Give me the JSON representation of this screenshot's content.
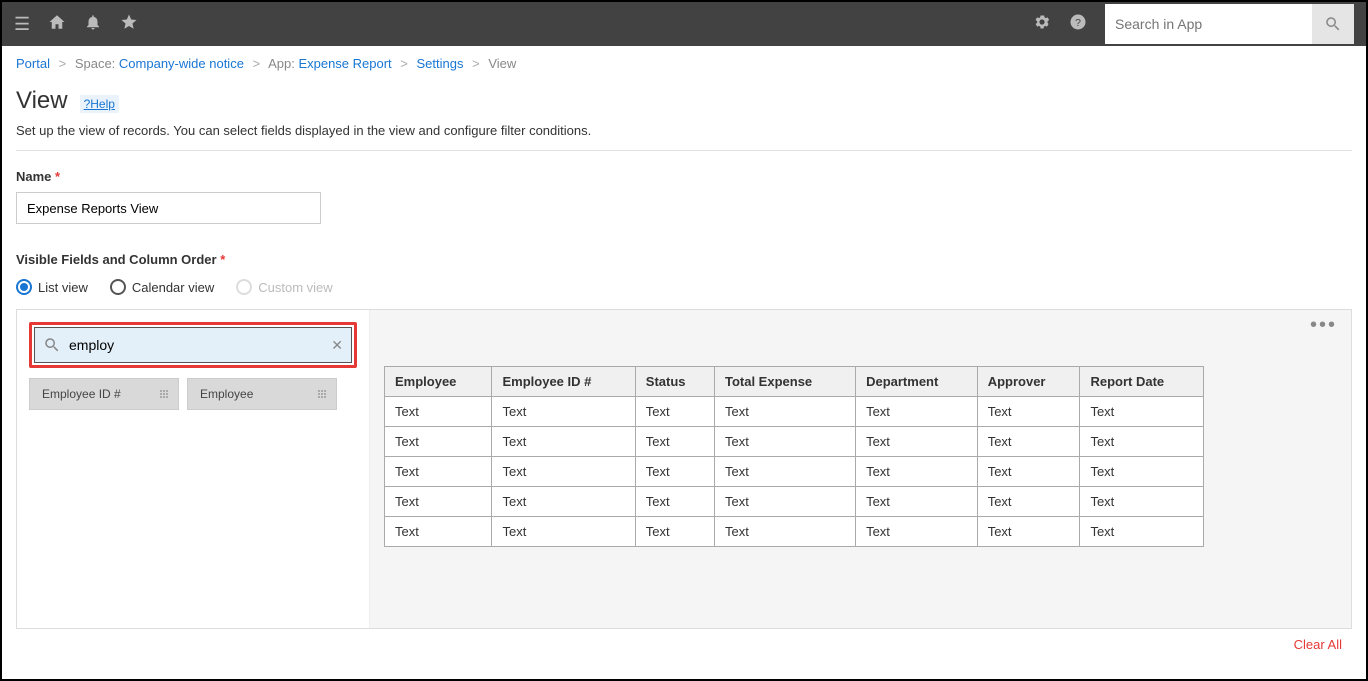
{
  "topbar": {
    "search_placeholder": "Search in App"
  },
  "breadcrumb": {
    "portal": "Portal",
    "space_label": "Space:",
    "space_name": "Company-wide notice",
    "app_label": "App:",
    "app_name": "Expense Report",
    "settings": "Settings",
    "current": "View"
  },
  "page": {
    "title": "View",
    "help": "?Help",
    "description": "Set up the view of records. You can select fields displayed in the view and configure filter conditions."
  },
  "name_section": {
    "label": "Name",
    "value": "Expense Reports View"
  },
  "fields_section": {
    "label": "Visible Fields and Column Order",
    "radios": {
      "list": "List view",
      "calendar": "Calendar view",
      "custom": "Custom view"
    },
    "search_value": "employ",
    "chips": [
      "Employee ID #",
      "Employee"
    ],
    "table": {
      "headers": [
        "Employee",
        "Employee ID #",
        "Status",
        "Total Expense",
        "Department",
        "Approver",
        "Report Date"
      ],
      "rows": [
        [
          "Text",
          "Text",
          "Text",
          "Text",
          "Text",
          "Text",
          "Text"
        ],
        [
          "Text",
          "Text",
          "Text",
          "Text",
          "Text",
          "Text",
          "Text"
        ],
        [
          "Text",
          "Text",
          "Text",
          "Text",
          "Text",
          "Text",
          "Text"
        ],
        [
          "Text",
          "Text",
          "Text",
          "Text",
          "Text",
          "Text",
          "Text"
        ],
        [
          "Text",
          "Text",
          "Text",
          "Text",
          "Text",
          "Text",
          "Text"
        ]
      ]
    },
    "clear_all": "Clear All"
  }
}
